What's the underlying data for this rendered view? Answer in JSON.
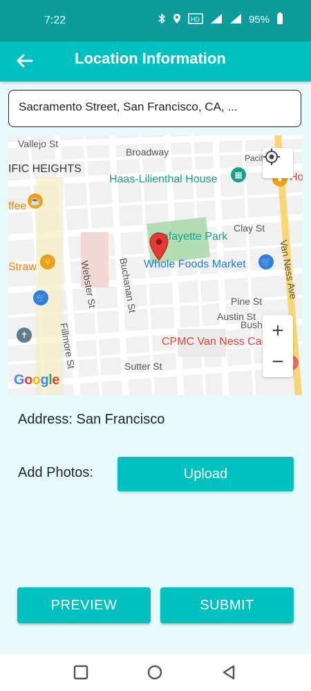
{
  "status_bar": {
    "time": "7:22",
    "battery": "95%"
  },
  "app_bar": {
    "title": "Location Information",
    "back_icon": "arrow-left-icon"
  },
  "search": {
    "value": "Sacramento Street, San Francisco, CA, ..."
  },
  "map": {
    "labels": {
      "vallejo": "Vallejo St",
      "broadway": "Broadway",
      "pacific_heights": "IFIC HEIGHTS",
      "haas": "Haas-Lilienthal House",
      "pacific": "Pacific",
      "hotel": "Ho",
      "ffee": "ffee",
      "lafayette": "Lafayette Park",
      "clay": "Clay St",
      "straw": "Straw",
      "whole_foods": "Whole Foods Market",
      "webster": "Webster St",
      "buchanan": "Buchanan St",
      "van_ness": "Van Ness Ave",
      "pine": "Pine St",
      "austin": "Austin St",
      "bush": "Bush St",
      "fillmore": "Fillmore St",
      "cpmc": "CPMC Van Ness Campus",
      "sutter": "Sutter St",
      "google": "Google"
    }
  },
  "address": {
    "text": "Address: San Francisco"
  },
  "photos": {
    "label": "Add Photos:",
    "upload_label": "Upload"
  },
  "actions": {
    "preview_label": "PREVIEW",
    "submit_label": "SUBMIT"
  },
  "colors": {
    "primary": "#00C1C0",
    "status": "#0D9C9A",
    "background": "#E8FBFC"
  }
}
